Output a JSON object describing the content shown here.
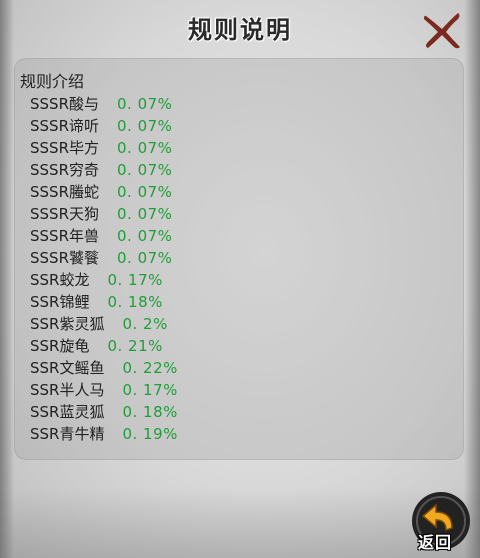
{
  "header": {
    "title": "规则说明"
  },
  "panel": {
    "heading": "规则介绍",
    "rows": [
      {
        "name": "SSSR酸与",
        "rate": "0. 07%"
      },
      {
        "name": "SSSR谛听",
        "rate": "0. 07%"
      },
      {
        "name": "SSSR毕方",
        "rate": "0. 07%"
      },
      {
        "name": "SSSR穷奇",
        "rate": "0. 07%"
      },
      {
        "name": "SSSR螣蛇",
        "rate": "0. 07%"
      },
      {
        "name": "SSSR天狗",
        "rate": "0. 07%"
      },
      {
        "name": "SSSR年兽",
        "rate": "0. 07%"
      },
      {
        "name": "SSSR饕餮",
        "rate": "0. 07%"
      },
      {
        "name": "SSR蛟龙",
        "rate": "0. 17%"
      },
      {
        "name": "SSR锦鲤",
        "rate": "0. 18%"
      },
      {
        "name": "SSR紫灵狐",
        "rate": "0. 2%"
      },
      {
        "name": "SSR旋龟",
        "rate": "0. 21%"
      },
      {
        "name": "SSR文鳐鱼",
        "rate": "0. 22%"
      },
      {
        "name": "SSR半人马",
        "rate": "0. 17%"
      },
      {
        "name": "SSR蓝灵狐",
        "rate": "0. 18%"
      },
      {
        "name": "SSR青牛精",
        "rate": "0. 19%"
      }
    ]
  },
  "footer": {
    "back_label": "返回"
  },
  "icons": {
    "close": "close-x-icon",
    "back": "back-arrow-icon"
  },
  "colors": {
    "rate_text": "#1f9e37",
    "close_icon": "#7a2a1e",
    "back_arrow": "#f0a81e"
  }
}
